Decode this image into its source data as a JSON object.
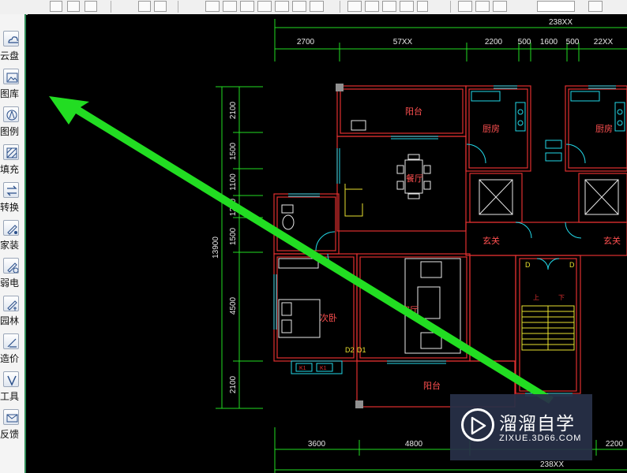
{
  "toolbar": {
    "zoom_value": "…"
  },
  "sidebar": {
    "items": [
      {
        "label": "云盘",
        "icon": "cloud-icon"
      },
      {
        "label": "图库",
        "icon": "picture-icon"
      },
      {
        "label": "图例",
        "icon": "legend-icon"
      },
      {
        "label": "填充",
        "icon": "hatch-icon"
      },
      {
        "label": "转换",
        "icon": "convert-icon"
      },
      {
        "label": "家装",
        "icon": "home-decor-icon"
      },
      {
        "label": "弱电",
        "icon": "low-voltage-icon"
      },
      {
        "label": "园林",
        "icon": "garden-icon"
      },
      {
        "label": "造价",
        "icon": "cost-icon"
      },
      {
        "label": "工具",
        "icon": "tools-icon"
      },
      {
        "label": "反馈",
        "icon": "feedback-icon"
      }
    ]
  },
  "drawing": {
    "dims_top": {
      "overall": "238XX",
      "segments": [
        "2700",
        "57XX",
        "2200",
        "500",
        "1600",
        "500",
        "22XX"
      ]
    },
    "dims_left": {
      "overall": "13900",
      "segments": [
        "2100",
        "1500",
        "1100",
        "1200",
        "1500",
        "4500",
        "2100"
      ]
    },
    "dims_bottom": {
      "segments": [
        "3600",
        "4800",
        "2200"
      ],
      "overall": "238XX"
    },
    "rooms": {
      "balcony_top": "阳台",
      "kitchen_1": "厨房",
      "kitchen_2": "厨房",
      "dining": "餐厅",
      "foyer_1": "玄关",
      "foyer_2": "玄关",
      "second_bedroom": "次卧",
      "living": "客厅",
      "balcony_bottom": "阳台"
    },
    "tags": {
      "d_left": "D",
      "d_right": "D",
      "door_d2": "D2",
      "door_d1": "D1",
      "window_1": "K1",
      "window_2": "K1",
      "up_1": "上",
      "up_2": "下"
    }
  },
  "annotation": {
    "arrow_color": "#22dd22"
  },
  "watermark": {
    "title": "溜溜自学",
    "subtitle": "ZIXUE.3D66.COM"
  }
}
